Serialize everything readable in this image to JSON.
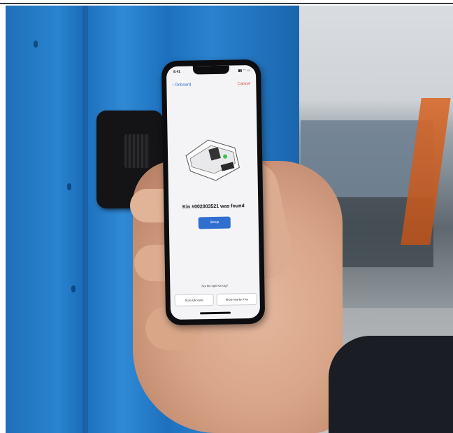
{
  "phone": {
    "status_time": "9:41",
    "status_icons": "▮▮ ◠ ▭",
    "nav_back_label": "‹ Onboard",
    "nav_cancel_label": "Cancel",
    "found_text": "Kin #002003521 was found",
    "setup_button_label": "Setup",
    "help_text": "Not the right Kin tag?",
    "scan_qr_label": "Scan QR code",
    "show_nearby_label": "Show nearby Kins"
  },
  "colors": {
    "pillar_blue": "#2a84d0",
    "setup_button": "#2f6fd0",
    "cancel_red": "#e0453a",
    "indicator_green": "#36c24a"
  }
}
